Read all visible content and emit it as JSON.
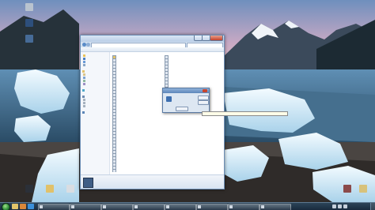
{
  "desktop": {
    "icons": [
      {
        "label": "",
        "icon": "recycle-bin-icon",
        "color": "#b9c3cf"
      },
      {
        "label": "",
        "icon": "app-icon",
        "color": "#2d4f7c"
      },
      {
        "label": "",
        "icon": "app-icon",
        "color": "#466b97"
      },
      {
        "label": "",
        "icon": "app-icon",
        "color": "#2b3038"
      },
      {
        "label": "",
        "icon": "folder-icon",
        "color": "#e1c16a"
      },
      {
        "label": "",
        "icon": "app-icon",
        "color": "#d9dde2"
      },
      {
        "label": "",
        "icon": "app-icon",
        "color": "#8b4a4a"
      },
      {
        "label": "",
        "icon": "folder-icon",
        "color": "#d8c27a"
      }
    ]
  },
  "explorer": {
    "address": "",
    "search_placeholder": "",
    "toolbar_items": [
      "",
      "",
      "",
      ""
    ],
    "nav_items": [
      {
        "label": "",
        "icon": "favorites-icon"
      },
      {
        "label": "",
        "icon": "desktop-icon"
      },
      {
        "label": "",
        "icon": "downloads-icon"
      },
      {
        "label": "",
        "icon": "recent-icon"
      },
      {
        "label": "",
        "icon": "libraries-icon"
      },
      {
        "label": "",
        "icon": "documents-icon"
      },
      {
        "label": "",
        "icon": "music-icon"
      },
      {
        "label": "",
        "icon": "pictures-icon"
      },
      {
        "label": "",
        "icon": "videos-icon"
      },
      {
        "label": "",
        "icon": "homegroup-icon"
      },
      {
        "label": "",
        "icon": "computer-icon"
      },
      {
        "label": "",
        "icon": "drive-icon"
      },
      {
        "label": "",
        "icon": "drive-icon"
      },
      {
        "label": "",
        "icon": "drive-icon"
      },
      {
        "label": "",
        "icon": "network-icon"
      }
    ],
    "files_col1": [
      {
        "name": "",
        "icon": "folder-icon"
      },
      {
        "name": "",
        "icon": "file-icon"
      },
      {
        "name": "",
        "icon": "file-icon"
      },
      {
        "name": "",
        "icon": "file-icon"
      },
      {
        "name": "",
        "icon": "file-icon"
      },
      {
        "name": "",
        "icon": "file-icon"
      },
      {
        "name": "",
        "icon": "file-icon"
      },
      {
        "name": "",
        "icon": "file-icon"
      },
      {
        "name": "",
        "icon": "file-icon"
      },
      {
        "name": "",
        "icon": "file-icon"
      },
      {
        "name": "",
        "icon": "file-icon"
      },
      {
        "name": "",
        "icon": "file-icon"
      },
      {
        "name": "",
        "icon": "file-icon"
      },
      {
        "name": "",
        "icon": "file-icon"
      },
      {
        "name": "",
        "icon": "file-icon"
      },
      {
        "name": "",
        "icon": "file-icon"
      },
      {
        "name": "",
        "icon": "file-icon"
      },
      {
        "name": "",
        "icon": "file-icon"
      },
      {
        "name": "",
        "icon": "file-icon"
      },
      {
        "name": "",
        "icon": "file-icon"
      },
      {
        "name": "",
        "icon": "file-icon"
      },
      {
        "name": "",
        "icon": "file-icon"
      },
      {
        "name": "",
        "icon": "file-icon"
      },
      {
        "name": "",
        "icon": "file-icon"
      },
      {
        "name": "",
        "icon": "file-icon"
      },
      {
        "name": "",
        "icon": "file-icon"
      },
      {
        "name": "",
        "icon": "file-icon"
      },
      {
        "name": "",
        "icon": "file-icon"
      },
      {
        "name": "",
        "icon": "file-icon"
      },
      {
        "name": "",
        "icon": "file-icon"
      },
      {
        "name": "",
        "icon": "file-icon"
      },
      {
        "name": "",
        "icon": "file-icon"
      },
      {
        "name": "",
        "icon": "file-icon"
      },
      {
        "name": "",
        "icon": "file-icon"
      },
      {
        "name": "",
        "icon": "file-icon"
      },
      {
        "name": "",
        "icon": "file-icon"
      },
      {
        "name": "",
        "icon": "file-icon"
      }
    ],
    "files_col2": [
      {
        "name": "",
        "icon": "file-icon"
      },
      {
        "name": "",
        "icon": "file-icon"
      },
      {
        "name": "",
        "icon": "file-icon"
      },
      {
        "name": "",
        "icon": "file-icon"
      },
      {
        "name": "",
        "icon": "file-icon"
      },
      {
        "name": "",
        "icon": "file-icon"
      },
      {
        "name": "",
        "icon": "file-icon"
      },
      {
        "name": "",
        "icon": "file-icon"
      },
      {
        "name": "",
        "icon": "file-icon"
      },
      {
        "name": "",
        "icon": "file-icon"
      },
      {
        "name": "",
        "icon": "file-icon"
      },
      {
        "name": "",
        "icon": "file-icon"
      },
      {
        "name": "",
        "icon": "file-icon"
      },
      {
        "name": "",
        "icon": "file-icon"
      },
      {
        "name": "",
        "icon": "file-icon"
      },
      {
        "name": "",
        "icon": "file-icon"
      }
    ],
    "details": {
      "name": "",
      "line1": "",
      "line2": "",
      "line3": ""
    }
  },
  "dialog": {
    "title": "",
    "text": "",
    "button1": "",
    "button2": "",
    "button3": ""
  },
  "tooltip": "",
  "taskbar": {
    "pinned": [
      {
        "icon": "explorer-icon",
        "color": "#e2c56a"
      },
      {
        "icon": "browser-icon",
        "color": "#d9873a"
      },
      {
        "icon": "media-icon",
        "color": "#3a8fd9"
      }
    ],
    "tasks": [
      {
        "label": ""
      },
      {
        "label": ""
      },
      {
        "label": ""
      },
      {
        "label": ""
      },
      {
        "label": ""
      },
      {
        "label": ""
      },
      {
        "label": ""
      },
      {
        "label": ""
      }
    ],
    "clock_time": "",
    "clock_date": ""
  },
  "colors": {
    "file_icon": "#dfe6ef",
    "folder": "#e4c46a",
    "selection": "#cde4fb"
  }
}
